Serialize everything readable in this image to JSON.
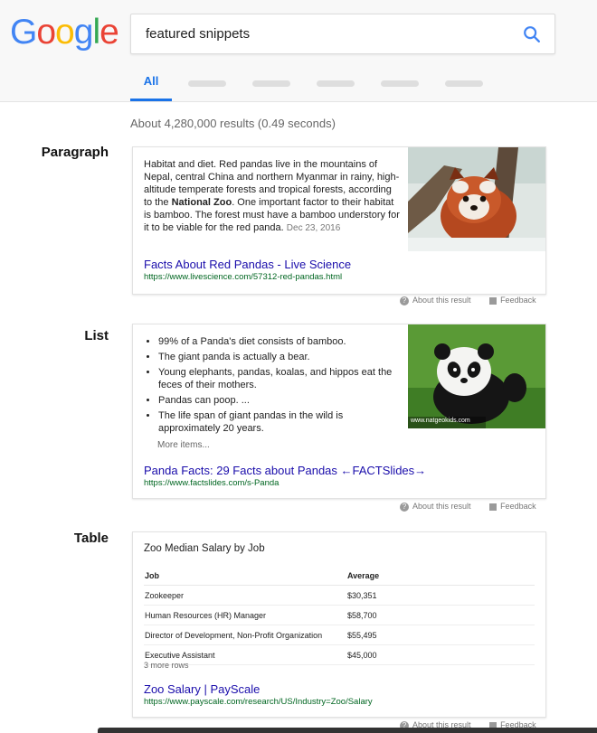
{
  "logo": {
    "letters": [
      "G",
      "o",
      "o",
      "g",
      "l",
      "e"
    ]
  },
  "colors": {
    "blue": "#4285f4",
    "red": "#ea4335",
    "yellow": "#fbbc05",
    "green": "#34a853",
    "link": "#1a0dab",
    "url": "#006621"
  },
  "search": {
    "query": "featured snippets",
    "icon": "search-icon"
  },
  "tabs": {
    "active": "All"
  },
  "stats": "About 4,280,000 results (0.49 seconds)",
  "sections": {
    "paragraph": {
      "label": "Paragraph",
      "text_before": "Habitat and diet. Red pandas live in the mountains of Nepal, central China and northern Myanmar in rainy, high-altitude temperate forests and tropical forests, according to the ",
      "text_bold": "National Zoo",
      "text_after": ". One important factor to their habitat is bamboo. The forest must have a bamboo understory for it to be viable for the red panda.",
      "date": "Dec 23, 2016",
      "link_title": "Facts About Red Pandas - Live Science",
      "link_url": "https://www.livescience.com/57312-red-pandas.html"
    },
    "list": {
      "label": "List",
      "items": [
        "99% of a Panda's diet consists of bamboo.",
        "The giant panda is actually a bear.",
        "Young elephants, pandas, koalas, and hippos eat the feces of their mothers.",
        "Pandas can poop. ...",
        "The life span of giant pandas in the wild is approximately 20 years."
      ],
      "more": "More items...",
      "image_caption": "www.natgeokids.com",
      "link_title": "Panda Facts: 29 Facts about Pandas ←FACTSlides→",
      "link_url": "https://www.factslides.com/s-Panda"
    },
    "table": {
      "label": "Table",
      "title": "Zoo Median Salary by Job",
      "headers": [
        "Job",
        "Average"
      ],
      "rows": [
        [
          "Zookeeper",
          "$30,351"
        ],
        [
          "Human Resources (HR) Manager",
          "$58,700"
        ],
        [
          "Director of Development, Non-Profit Organization",
          "$55,495"
        ],
        [
          "Executive Assistant",
          "$45,000"
        ]
      ],
      "more": "3 more rows",
      "link_title": "Zoo Salary | PayScale",
      "link_url": "https://www.payscale.com/research/US/Industry=Zoo/Salary"
    }
  },
  "below_card": {
    "about": "About this result",
    "feedback": "Feedback"
  }
}
